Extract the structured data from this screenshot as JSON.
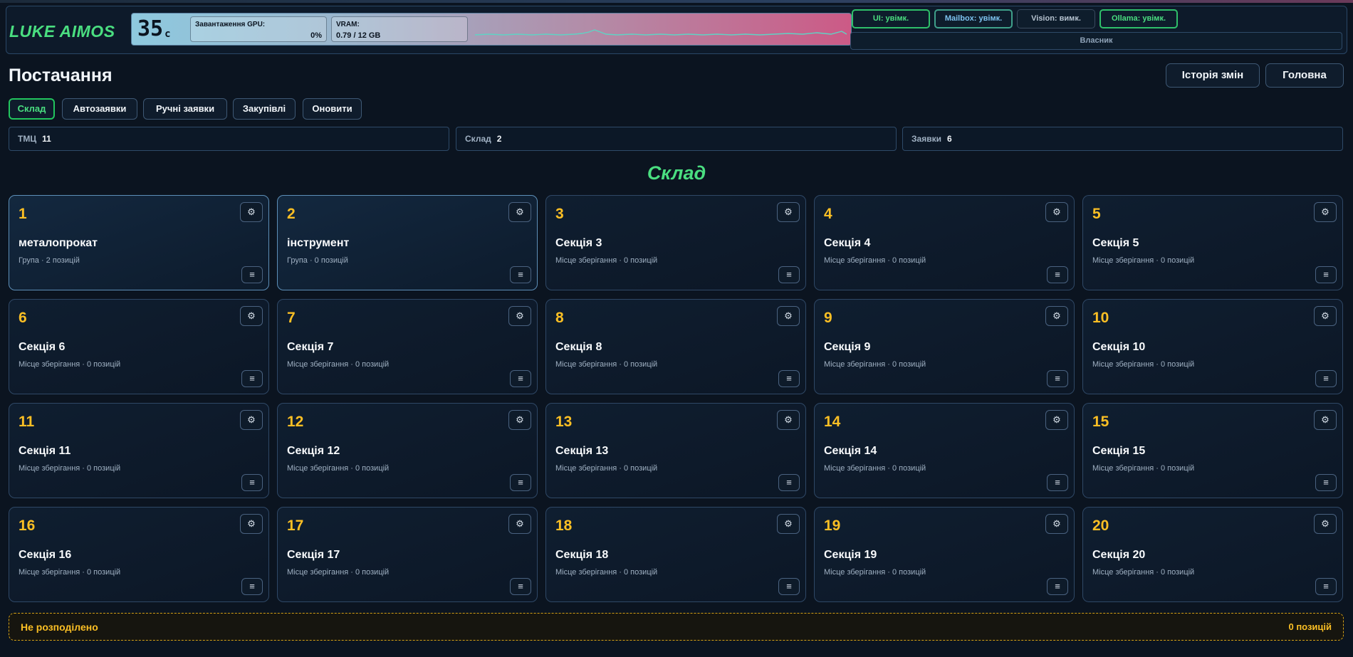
{
  "app": {
    "brand": "LUKE AIMOS"
  },
  "monitor": {
    "temperature": "35",
    "temperature_unit": "c",
    "gpu_label": "Завантаження GPU:",
    "gpu_value": "0%",
    "vram_label": "VRAM:",
    "vram_value": "0.79 / 12 GB"
  },
  "status": {
    "ui": "UI: увімк.",
    "mailbox": "Mailbox: увімк.",
    "vision": "Vision: вимк.",
    "ollama": "Ollama: увімк.",
    "owner": "Власник"
  },
  "page": {
    "title": "Постачання",
    "history_button": "Історія змін",
    "main_button": "Головна"
  },
  "tabs": [
    "Склад",
    "Автозаявки",
    "Ручні заявки",
    "Закупівлі",
    "Оновити"
  ],
  "stats": [
    {
      "label": "ТМЦ",
      "value": "11"
    },
    {
      "label": "Склад",
      "value": "2"
    },
    {
      "label": "Заявки",
      "value": "6"
    }
  ],
  "section_title": "Склад",
  "cards": [
    {
      "num": "1",
      "name": "металопрокат",
      "meta": "Група · 2 позицій",
      "kind": "group"
    },
    {
      "num": "2",
      "name": "інструмент",
      "meta": "Група · 0 позицій",
      "kind": "group"
    },
    {
      "num": "3",
      "name": "Секція 3",
      "meta": "Місце зберігання · 0 позицій",
      "kind": "storage"
    },
    {
      "num": "4",
      "name": "Секція 4",
      "meta": "Місце зберігання · 0 позицій",
      "kind": "storage"
    },
    {
      "num": "5",
      "name": "Секція 5",
      "meta": "Місце зберігання · 0 позицій",
      "kind": "storage"
    },
    {
      "num": "6",
      "name": "Секція 6",
      "meta": "Місце зберігання · 0 позицій",
      "kind": "storage"
    },
    {
      "num": "7",
      "name": "Секція 7",
      "meta": "Місце зберігання · 0 позицій",
      "kind": "storage"
    },
    {
      "num": "8",
      "name": "Секція 8",
      "meta": "Місце зберігання · 0 позицій",
      "kind": "storage"
    },
    {
      "num": "9",
      "name": "Секція 9",
      "meta": "Місце зберігання · 0 позицій",
      "kind": "storage"
    },
    {
      "num": "10",
      "name": "Секція 10",
      "meta": "Місце зберігання · 0 позицій",
      "kind": "storage"
    },
    {
      "num": "11",
      "name": "Секція 11",
      "meta": "Місце зберігання · 0 позицій",
      "kind": "storage"
    },
    {
      "num": "12",
      "name": "Секція 12",
      "meta": "Місце зберігання · 0 позицій",
      "kind": "storage"
    },
    {
      "num": "13",
      "name": "Секція 13",
      "meta": "Місце зберігання · 0 позицій",
      "kind": "storage"
    },
    {
      "num": "14",
      "name": "Секція 14",
      "meta": "Місце зберігання · 0 позицій",
      "kind": "storage"
    },
    {
      "num": "15",
      "name": "Секція 15",
      "meta": "Місце зберігання · 0 позицій",
      "kind": "storage"
    },
    {
      "num": "16",
      "name": "Секція 16",
      "meta": "Місце зберігання · 0 позицій",
      "kind": "storage"
    },
    {
      "num": "17",
      "name": "Секція 17",
      "meta": "Місце зберігання · 0 позицій",
      "kind": "storage"
    },
    {
      "num": "18",
      "name": "Секція 18",
      "meta": "Місце зберігання · 0 позицій",
      "kind": "storage"
    },
    {
      "num": "19",
      "name": "Секція 19",
      "meta": "Місце зберігання · 0 позицій",
      "kind": "storage"
    },
    {
      "num": "20",
      "name": "Секція 20",
      "meta": "Місце зберігання · 0 позицій",
      "kind": "storage"
    }
  ],
  "card_icons": {
    "settings": "gear-icon",
    "menu": "menu-icon"
  },
  "unassigned": {
    "label": "Не розподілено",
    "count": "0 позицій"
  },
  "colors": {
    "accent_green": "#4ade80",
    "number_yellow": "#fbbf24",
    "background": "#0b1420"
  }
}
